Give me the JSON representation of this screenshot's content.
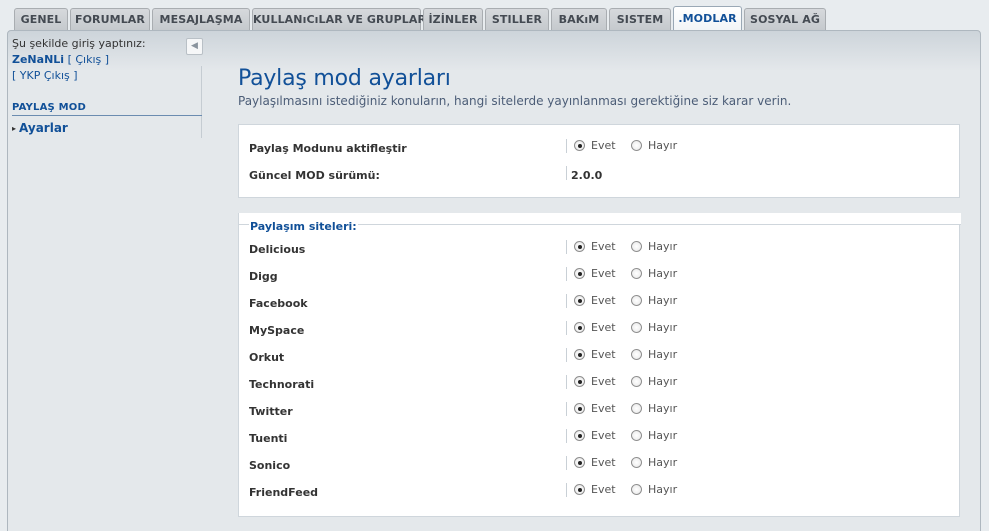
{
  "tabs": [
    {
      "label": "GENEL"
    },
    {
      "label": "FORUMLAR"
    },
    {
      "label": "MESAJLAŞMA"
    },
    {
      "label": "KULLANıCıLAR VE GRUPLAR"
    },
    {
      "label": "İZİNLER"
    },
    {
      "label": "STILLER"
    },
    {
      "label": "BAKıM"
    },
    {
      "label": "SISTEM"
    },
    {
      "label": ".MODLAR"
    },
    {
      "label": "SOSYAL AĞ"
    }
  ],
  "sidebar": {
    "login_text": "Şu şekilde giriş yaptınız:",
    "username": "ZeNaNLi",
    "logout_label": "[ Çıkış ]",
    "ykp_logout_label": "[ YKP Çıkış ]",
    "menu_heading": "PAYLAŞ MOD",
    "menu_item": "Ayarlar"
  },
  "main": {
    "title": "Paylaş mod ayarları",
    "description": "Paylaşılmasını istediğiniz konuların, hangi sitelerde yayınlanması gerektiğine siz karar verin.",
    "yes_label": "Evet",
    "no_label": "Hayır",
    "general": {
      "activate_label": "Paylaş Modunu aktifleştir",
      "activate_value": "Evet",
      "version_label": "Güncel MOD sürümü:",
      "version_value": "2.0.0"
    },
    "sites_legend": "Paylaşım siteleri:",
    "sites": [
      {
        "name": "Delicious",
        "value": "Evet"
      },
      {
        "name": "Digg",
        "value": "Evet"
      },
      {
        "name": "Facebook",
        "value": "Evet"
      },
      {
        "name": "MySpace",
        "value": "Evet"
      },
      {
        "name": "Orkut",
        "value": "Evet"
      },
      {
        "name": "Technorati",
        "value": "Evet"
      },
      {
        "name": "Twitter",
        "value": "Evet"
      },
      {
        "name": "Tuenti",
        "value": "Evet"
      },
      {
        "name": "Sonico",
        "value": "Evet"
      },
      {
        "name": "FriendFeed",
        "value": "Evet"
      }
    ]
  },
  "colors": {
    "accent": "#115098",
    "background": "#e8ecef"
  }
}
